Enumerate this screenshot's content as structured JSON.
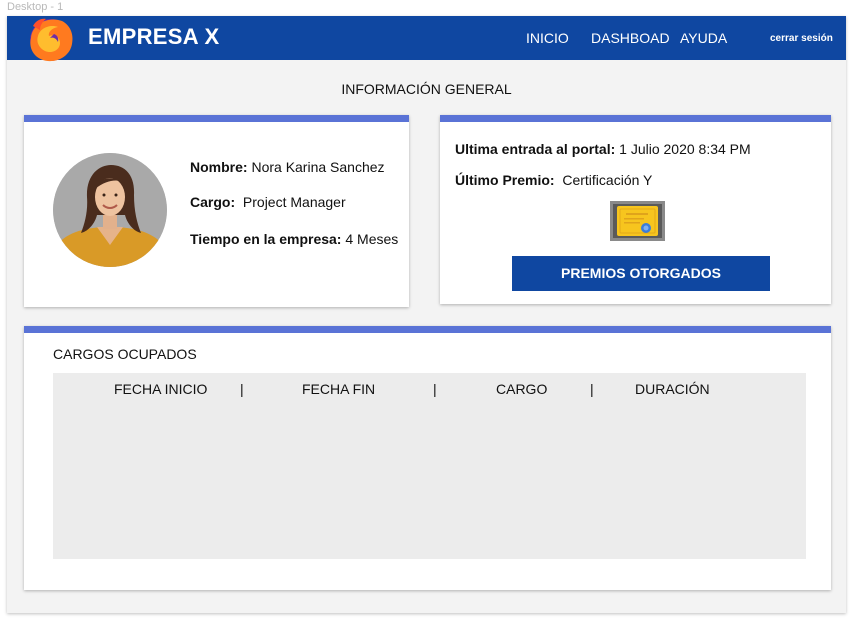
{
  "artboard": {
    "label": "Desktop - 1"
  },
  "navbar": {
    "brand": "EMPRESA X",
    "links": [
      {
        "label": "INICIO"
      },
      {
        "label": "DASHBOAD"
      },
      {
        "label": "AYUDA"
      }
    ],
    "logout_label": "cerrar sesión",
    "logo_icon": "firefox-logo-icon",
    "color": "#0f47a1"
  },
  "page": {
    "title": "INFORMACIÓN GENERAL"
  },
  "profile": {
    "avatar_icon": "user-photo-avatar",
    "name_label": "Nombre:",
    "name_value": "Nora Karina Sanchez",
    "role_label": "Cargo:",
    "role_value": "Project Manager",
    "tenure_label": "Tiempo en la empresa:",
    "tenure_value": "4 Meses"
  },
  "portal": {
    "last_login_label": "Ultima entrada al portal:",
    "last_login_value": "1 Julio 2020 8:34 PM",
    "last_award_label": "Último Premio:",
    "last_award_value": "Certificación Y",
    "award_icon": "certificate-icon",
    "awards_button_label": "PREMIOS OTORGADOS"
  },
  "positions": {
    "title": "CARGOS OCUPADOS",
    "columns": [
      "FECHA INICIO",
      "FECHA FIN",
      "CARGO",
      "DURACIÓN"
    ],
    "separator": "|",
    "rows": []
  },
  "colors": {
    "accent_bar": "#5a73d6",
    "table_bg": "#ececec",
    "frame_bg": "#f3f3f3"
  }
}
